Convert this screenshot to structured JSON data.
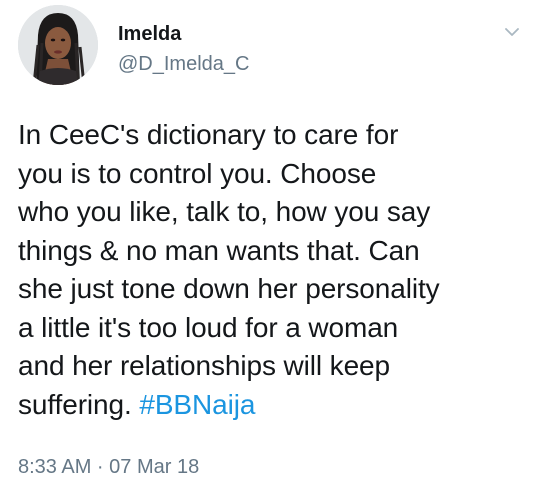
{
  "author": {
    "display_name": "Imelda",
    "handle": "@D_Imelda_C",
    "avatar_icon": "profile-photo"
  },
  "menu": {
    "icon": "chevron-down-icon"
  },
  "tweet": {
    "text": "In CeeC's dictionary to care for\nyou is to control you. Choose\nwho you like, talk to, how you say\nthings & no man wants that. Can\nshe just tone down her personality\na little it's too loud for a woman\nand her relationships will keep\nsuffering. ",
    "hashtag": "#BBNaija",
    "hashtag_color": "#1b95e0"
  },
  "meta": {
    "timestamp": "8:33 AM · 07 Mar 18"
  }
}
